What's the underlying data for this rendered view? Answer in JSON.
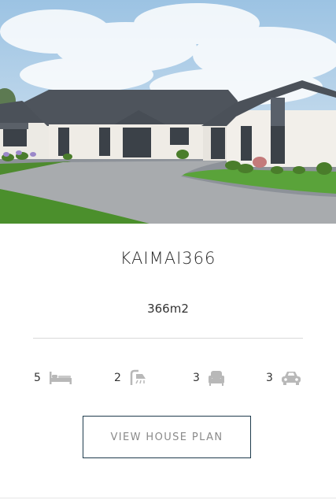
{
  "listing": {
    "title": "KAIMAI366",
    "area": "366m2",
    "features": [
      {
        "count": "5",
        "icon": "bed-icon"
      },
      {
        "count": "2",
        "icon": "shower-icon"
      },
      {
        "count": "3",
        "icon": "armchair-icon"
      },
      {
        "count": "3",
        "icon": "car-icon"
      }
    ],
    "cta_label": "VIEW HOUSE PLAN"
  },
  "colors": {
    "button_border": "#1f3c4d",
    "icon_gray": "#b8b8b8",
    "roof": "#4b5159",
    "wall": "#efece6",
    "lawn": "#5f9e3a"
  }
}
